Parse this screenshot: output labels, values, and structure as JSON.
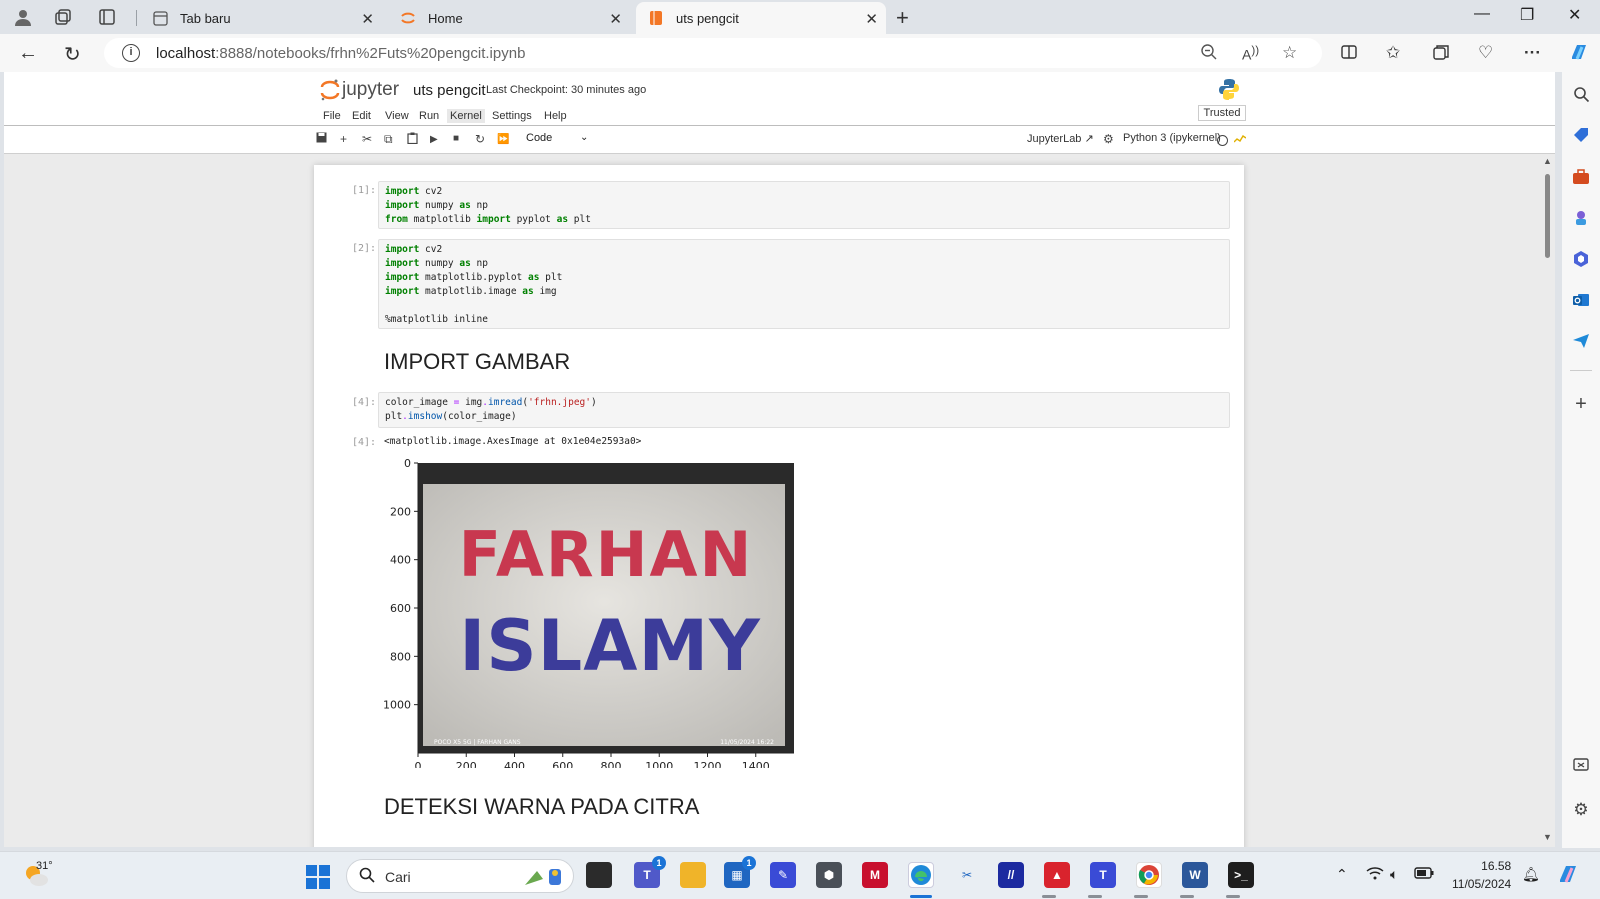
{
  "tabs": [
    {
      "label": "Tab baru"
    },
    {
      "label": "Home"
    },
    {
      "label": "uts pengcit"
    }
  ],
  "address": {
    "host": "localhost",
    "path": ":8888/notebooks/frhn%2Futs%20pengcit.ipynb"
  },
  "jupyter": {
    "logo_text": "jupyter",
    "notebook_title": "uts pengcit",
    "checkpoint": "Last Checkpoint: 30 minutes ago",
    "trusted": "Trusted",
    "menu": [
      "File",
      "Edit",
      "View",
      "Run",
      "Kernel",
      "Settings",
      "Help"
    ],
    "cell_type": "Code",
    "jupyterlab_link": "JupyterLab",
    "kernel": "Python 3 (ipykernel)"
  },
  "cells": {
    "c1_prompt": "[1]:",
    "c2_prompt": "[2]:",
    "c4_prompt": "[4]:",
    "out4_prompt": "[4]:",
    "heading1": "IMPORT GAMBAR",
    "heading2": "DETEKSI WARNA PADA CITRA",
    "out4_text": "<matplotlib.image.AxesImage at 0x1e04e2593a0>"
  },
  "plot": {
    "y_ticks": [
      "0",
      "200",
      "400",
      "600",
      "800",
      "1000"
    ],
    "x_ticks": [
      "0",
      "200",
      "400",
      "600",
      "800",
      "1000",
      "1200",
      "1400"
    ],
    "image_line1": "FARHAN",
    "image_line2": "ISLAMY",
    "watermark_left": "POCO X5 5G | FARHAN GANS",
    "watermark_right": "11/05/2024 16:22"
  },
  "taskbar": {
    "temp": "31°",
    "search_placeholder": "Cari",
    "time": "16.58",
    "date": "11/05/2024",
    "badge_teams": "1",
    "badge_store": "1"
  },
  "colors": {
    "accent": "#1a73d6",
    "jupyter_orange": "#f37726"
  }
}
